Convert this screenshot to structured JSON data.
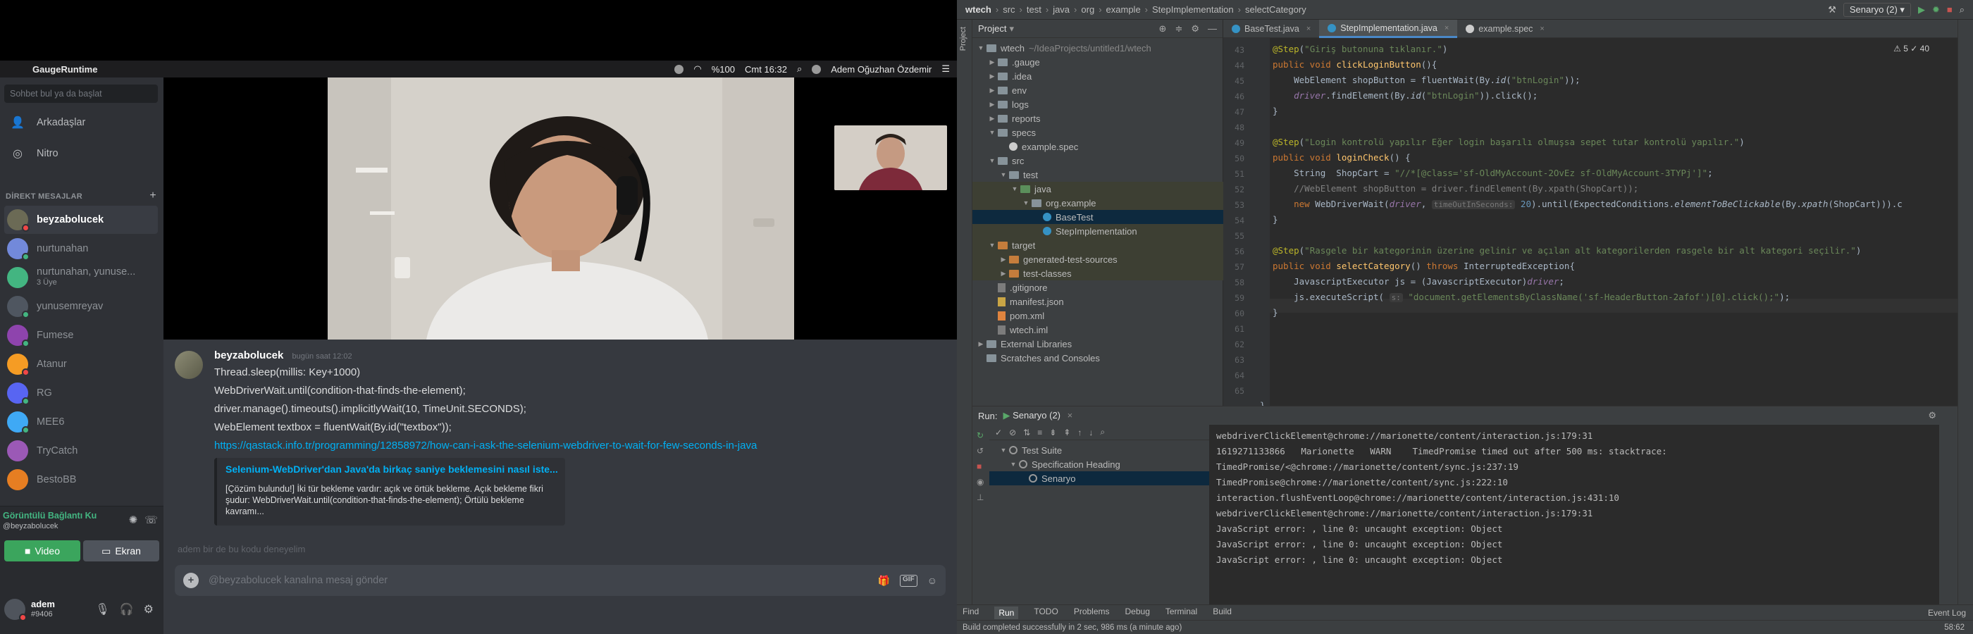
{
  "menubar": {
    "app_name": "GaugeRuntime",
    "battery": "%100",
    "clock": "Cmt 16:32",
    "user": "Adem Oğuzhan Özdemir"
  },
  "discord": {
    "search_placeholder": "Sohbet bul ya da başlat",
    "nav": [
      {
        "label": "Arkadaşlar"
      },
      {
        "label": "Nitro"
      }
    ],
    "dm_header": "DİREKT MESAJLAR",
    "dms": [
      {
        "name": "beyzabolucek",
        "sub": "",
        "color": "#6b6a55",
        "status": "#f04747",
        "active": true
      },
      {
        "name": "nurtunahan",
        "sub": "",
        "color": "#7289da",
        "status": "#43b581",
        "active": false
      },
      {
        "name": "nurtunahan, yunuse...",
        "sub": "3 Üye",
        "color": "#43b581",
        "status": "",
        "active": false
      },
      {
        "name": "yunusemreyav",
        "sub": "",
        "color": "#4f5660",
        "status": "#43b581",
        "active": false
      },
      {
        "name": "Fumese",
        "sub": "",
        "color": "#8e44ad",
        "status": "#43b581",
        "active": false
      },
      {
        "name": "Atanur",
        "sub": "",
        "color": "#f59c24",
        "status": "#f04747",
        "active": false
      },
      {
        "name": "RG",
        "sub": "",
        "color": "#5865f2",
        "status": "#43b581",
        "active": false
      },
      {
        "name": "MEE6",
        "sub": "",
        "color": "#3fa9f5",
        "status": "#43b581",
        "active": false
      },
      {
        "name": "TryCatch",
        "sub": "",
        "color": "#9b59b6",
        "status": "",
        "active": false
      },
      {
        "name": "BestoBB",
        "sub": "",
        "color": "#e67e22",
        "status": "",
        "active": false
      }
    ],
    "voice": {
      "connected": "Görüntülü Bağlantı Ku",
      "sub": "@beyzabolucek",
      "video_label": "Video",
      "screen_label": "Ekran"
    },
    "user": {
      "name": "adem",
      "tag": "#9406"
    },
    "message": {
      "author": "beyzabolucek",
      "time": "bugün saat 12:02",
      "lines": [
        "Thread.sleep(millis: Key+1000)",
        "WebDriverWait.until(condition-that-finds-the-element);",
        "driver.manage().timeouts().implicitlyWait(10, TimeUnit.SECONDS);",
        "WebElement textbox = fluentWait(By.id(\"textbox\"));"
      ],
      "link": "https://qastack.info.tr/programming/12858972/how-can-i-ask-the-selenium-webdriver-to-wait-for-few-seconds-in-java",
      "embed_title": "Selenium-WebDriver'dan Java'da birkaç saniye beklemesini nasıl iste...",
      "embed_desc": "[Çözüm bulundu!] İki tür bekleme vardır: açık ve örtük bekleme. Açık bekleme fikri şudur: WebDriverWait.until(condition-that-finds-the-element); Örtülü bekleme kavramı..."
    },
    "next_message": "adem  bir de bu kodu deneyelim",
    "input_placeholder": "@beyzabolucek kanalına mesaj gönder"
  },
  "ide": {
    "breadcrumbs": [
      "wtech",
      "src",
      "test",
      "java",
      "org",
      "example",
      "StepImplementation",
      "selectCategory"
    ],
    "run_config": "Senaryo (2)",
    "project_label": "Project",
    "tree": [
      {
        "label": "wtech",
        "extra": "~/IdeaProjects/untitled1/wtech",
        "indent": 0,
        "arrow": "▼",
        "icon": "fold",
        "sel": false,
        "hl": false
      },
      {
        "label": ".gauge",
        "extra": "",
        "indent": 1,
        "arrow": "▶",
        "icon": "fold",
        "sel": false,
        "hl": false
      },
      {
        "label": ".idea",
        "extra": "",
        "indent": 1,
        "arrow": "▶",
        "icon": "fold",
        "sel": false,
        "hl": false
      },
      {
        "label": "env",
        "extra": "",
        "indent": 1,
        "arrow": "▶",
        "icon": "fold",
        "sel": false,
        "hl": false
      },
      {
        "label": "logs",
        "extra": "",
        "indent": 1,
        "arrow": "▶",
        "icon": "fold",
        "sel": false,
        "hl": false
      },
      {
        "label": "reports",
        "extra": "",
        "indent": 1,
        "arrow": "▶",
        "icon": "fold",
        "sel": false,
        "hl": false
      },
      {
        "label": "specs",
        "extra": "",
        "indent": 1,
        "arrow": "▼",
        "icon": "fold",
        "sel": false,
        "hl": false
      },
      {
        "label": "example.spec",
        "extra": "",
        "indent": 2,
        "arrow": "",
        "icon": "spec",
        "sel": false,
        "hl": false
      },
      {
        "label": "src",
        "extra": "",
        "indent": 1,
        "arrow": "▼",
        "icon": "fold",
        "sel": false,
        "hl": false
      },
      {
        "label": "test",
        "extra": "",
        "indent": 2,
        "arrow": "▼",
        "icon": "fold",
        "sel": false,
        "hl": false
      },
      {
        "label": "java",
        "extra": "",
        "indent": 3,
        "arrow": "▼",
        "icon": "tst",
        "sel": false,
        "hl": true
      },
      {
        "label": "org.example",
        "extra": "",
        "indent": 4,
        "arrow": "▼",
        "icon": "pkg",
        "sel": false,
        "hl": true
      },
      {
        "label": "BaseTest",
        "extra": "",
        "indent": 5,
        "arrow": "",
        "icon": "cls",
        "sel": true,
        "hl": false
      },
      {
        "label": "StepImplementation",
        "extra": "",
        "indent": 5,
        "arrow": "",
        "icon": "cls",
        "sel": false,
        "hl": true
      },
      {
        "label": "target",
        "extra": "",
        "indent": 1,
        "arrow": "▼",
        "icon": "tgt",
        "sel": false,
        "hl": true
      },
      {
        "label": "generated-test-sources",
        "extra": "",
        "indent": 2,
        "arrow": "▶",
        "icon": "tgt",
        "sel": false,
        "hl": true
      },
      {
        "label": "test-classes",
        "extra": "",
        "indent": 2,
        "arrow": "▶",
        "icon": "tgt",
        "sel": false,
        "hl": true
      },
      {
        "label": ".gitignore",
        "extra": "",
        "indent": 1,
        "arrow": "",
        "icon": "iml",
        "sel": false,
        "hl": false
      },
      {
        "label": "manifest.json",
        "extra": "",
        "indent": 1,
        "arrow": "",
        "icon": "json",
        "sel": false,
        "hl": false
      },
      {
        "label": "pom.xml",
        "extra": "",
        "indent": 1,
        "arrow": "",
        "icon": "xml",
        "sel": false,
        "hl": false
      },
      {
        "label": "wtech.iml",
        "extra": "",
        "indent": 1,
        "arrow": "",
        "icon": "iml",
        "sel": false,
        "hl": false
      },
      {
        "label": "External Libraries",
        "extra": "",
        "indent": 0,
        "arrow": "▶",
        "icon": "pkg",
        "sel": false,
        "hl": false
      },
      {
        "label": "Scratches and Consoles",
        "extra": "",
        "indent": 0,
        "arrow": "",
        "icon": "pkg",
        "sel": false,
        "hl": false
      }
    ],
    "tabs": [
      {
        "label": "BaseTest.java",
        "active": false
      },
      {
        "label": "StepImplementation.java",
        "active": true
      },
      {
        "label": "example.spec",
        "active": false
      }
    ],
    "warnings": "⚠ 5  ✓ 40",
    "line_numbers": [
      "43",
      "44",
      "45",
      "46",
      "47",
      "48",
      "49",
      "50",
      "51",
      "52",
      "53",
      "54",
      "55",
      "56",
      "57",
      "58",
      "59",
      "60",
      "61",
      "62",
      "63",
      "64",
      "65"
    ],
    "run": {
      "label": "Run:",
      "tab": "Senaryo (2)",
      "tree": [
        {
          "label": "Test Suite",
          "indent": 1,
          "sel": false
        },
        {
          "label": "Specification Heading",
          "indent": 2,
          "sel": false
        },
        {
          "label": "Senaryo",
          "indent": 3,
          "sel": true
        }
      ],
      "console": [
        "webdriverClickElement@chrome://marionette/content/interaction.js:179:31",
        "1619271133866   Marionette   WARN    TimedPromise timed out after 500 ms: stacktrace:",
        "TimedPromise/<@chrome://marionette/content/sync.js:237:19",
        "TimedPromise@chrome://marionette/content/sync.js:222:10",
        "interaction.flushEventLoop@chrome://marionette/content/interaction.js:431:10",
        "webdriverClickElement@chrome://marionette/content/interaction.js:179:31",
        "JavaScript error: , line 0: uncaught exception: Object",
        "JavaScript error: , line 0: uncaught exception: Object",
        "JavaScript error: , line 0: uncaught exception: Object"
      ]
    },
    "bottom_tabs": [
      "Find",
      "Run",
      "TODO",
      "Problems",
      "Debug",
      "Terminal",
      "Build"
    ],
    "event_log": "Event Log",
    "status": "Build completed successfully in 2 sec, 986 ms (a minute ago)",
    "cursor_pos": "58:62"
  }
}
